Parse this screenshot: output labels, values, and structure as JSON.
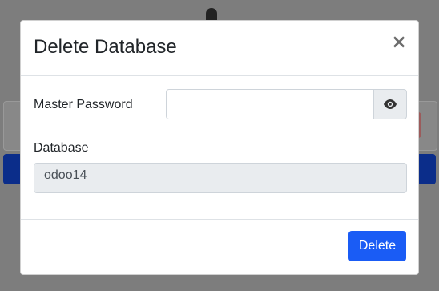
{
  "modal": {
    "title": "Delete Database",
    "close_label": "×"
  },
  "form": {
    "master_password_label": "Master Password",
    "master_password_value": "",
    "database_label": "Database",
    "database_value": "odoo14"
  },
  "footer": {
    "delete_label": "Delete"
  },
  "colors": {
    "primary": "#1a5cf5",
    "backdrop": "#7d7d7d",
    "readonly_bg": "#e9ecef"
  },
  "icons": {
    "password_toggle": "eye-icon"
  }
}
